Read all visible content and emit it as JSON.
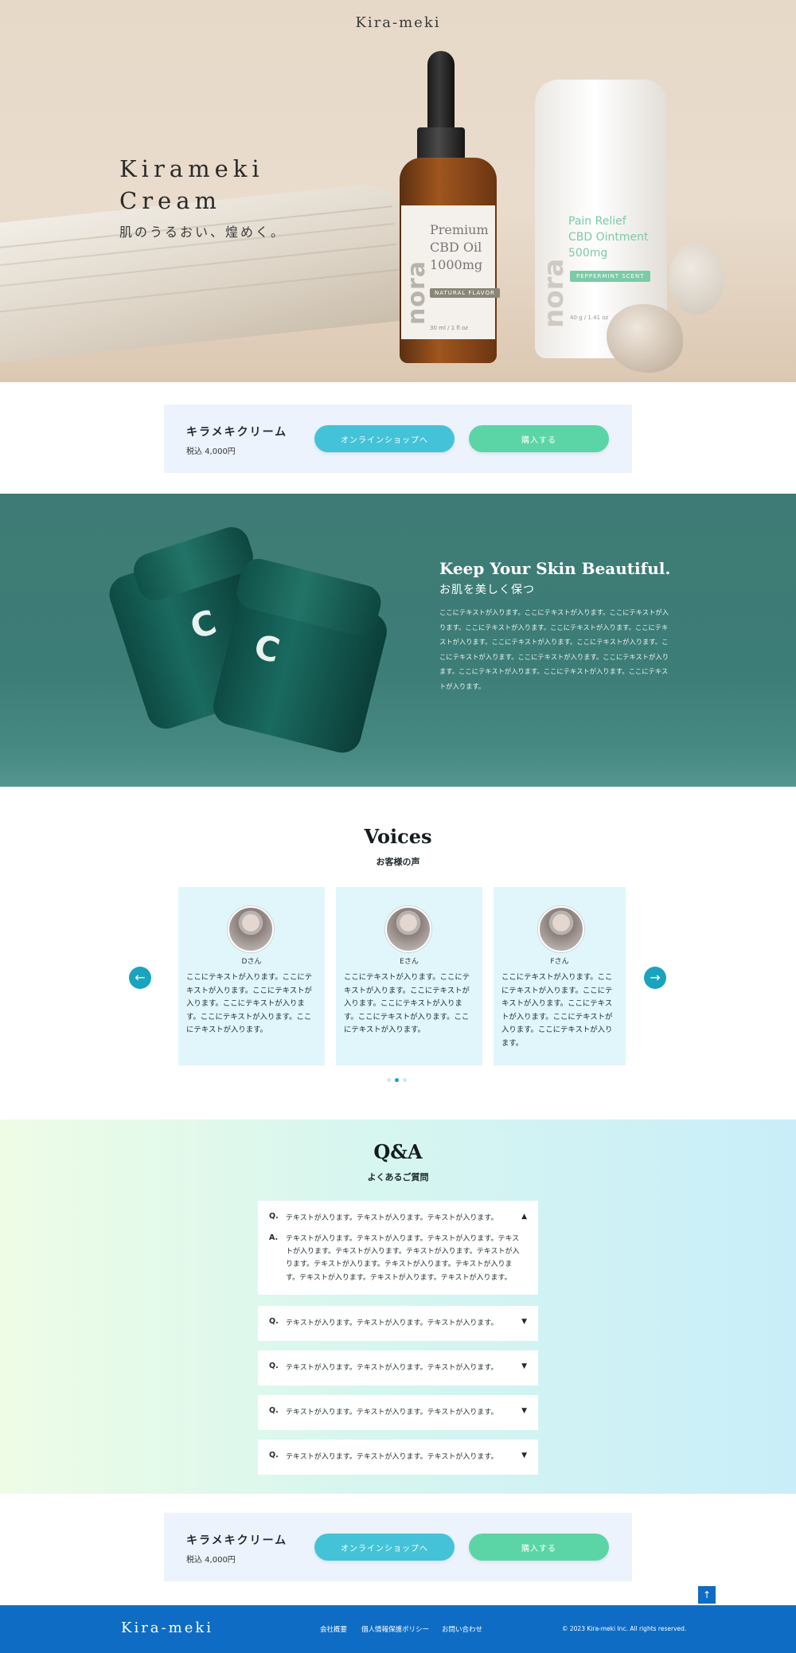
{
  "hero": {
    "logo": "Kira-meki",
    "title_line1": "Kirameki",
    "title_line2": "Cream",
    "subtitle": "肌のうるおい、煌めく。",
    "bottle": {
      "brand": "nora",
      "line1": "Premium",
      "line2": "CBD Oil",
      "line3": "1000mg",
      "tag": "NATURAL FLAVOR",
      "volume": "30 ml / 1 fl oz"
    },
    "tube": {
      "brand": "nora",
      "line1": "Pain Relief",
      "line2": "CBD Ointment",
      "line3": "500mg",
      "tag": "PEPPERMINT SCENT",
      "volume": "40 g / 1.41 oz"
    }
  },
  "cta": {
    "product_name": "キラメキクリーム",
    "price": "税込 4,000円",
    "shop_button": "オンラインショップへ",
    "buy_button": "購入する"
  },
  "feature": {
    "title": "Keep Your Skin Beautiful.",
    "subtitle": "お肌を美しく保つ",
    "body": "ここにテキストが入ります。ここにテキストが入ります。ここにテキストが入ります。ここにテキストが入ります。ここにテキストが入ります。ここにテキストが入ります。ここにテキストが入ります。ここにテキストが入ります。ここにテキストが入ります。ここにテキストが入ります。ここにテキストが入ります。ここにテキストが入ります。ここにテキストが入ります。ここにテキストが入ります。"
  },
  "voices": {
    "title": "Voices",
    "subtitle": "お客様の声",
    "cards": [
      {
        "name": "Dさん",
        "text": "ここにテキストが入ります。ここにテキストが入ります。ここにテキストが入ります。ここにテキストが入ります。ここにテキストが入ります。ここにテキストが入ります。"
      },
      {
        "name": "Eさん",
        "text": "ここにテキストが入ります。ここにテキストが入ります。ここにテキストが入ります。ここにテキストが入ります。ここにテキストが入ります。ここにテキストが入ります。"
      },
      {
        "name": "Fさん",
        "text": "ここにテキストが入ります。ここにテキストが入ります。ここにテキストが入ります。ここにテキストが入ります。ここにテキストが入ります。ここにテキストが入ります。"
      }
    ],
    "prev_icon": "arrow-left-icon",
    "next_icon": "arrow-right-icon",
    "page_count": 3,
    "active_page": 2
  },
  "qa": {
    "title": "Q&A",
    "subtitle": "よくあるご質問",
    "q_marker": "Q.",
    "a_marker": "A.",
    "items": [
      {
        "question": "テキストが入ります。テキストが入ります。テキストが入ります。",
        "answer": "テキストが入ります。テキストが入ります。テキストが入ります。テキストが入ります。テキストが入ります。テキストが入ります。テキストが入ります。テキストが入ります。テキストが入ります。テキストが入ります。テキストが入ります。テキストが入ります。テキストが入ります。",
        "expanded": true
      },
      {
        "question": "テキストが入ります。テキストが入ります。テキストが入ります。",
        "expanded": false
      },
      {
        "question": "テキストが入ります。テキストが入ります。テキストが入ります。",
        "expanded": false
      },
      {
        "question": "テキストが入ります。テキストが入ります。テキストが入ります。",
        "expanded": false
      },
      {
        "question": "テキストが入ります。テキストが入ります。テキストが入ります。",
        "expanded": false
      }
    ]
  },
  "footer": {
    "logo": "Kira-meki",
    "links": [
      "会社概要",
      "個人情報保護ポリシー",
      "お問い合わせ"
    ],
    "copyright": "© 2023 Kira-meki Inc. All rights reserved."
  },
  "colors": {
    "accent_cyan": "#44c3d8",
    "accent_green": "#5cd5a6",
    "teal_section": "#3e7b76",
    "footer_blue": "#0f6cc4",
    "voice_card": "#e0f6fa",
    "cta_bg": "#ecf3fc"
  }
}
